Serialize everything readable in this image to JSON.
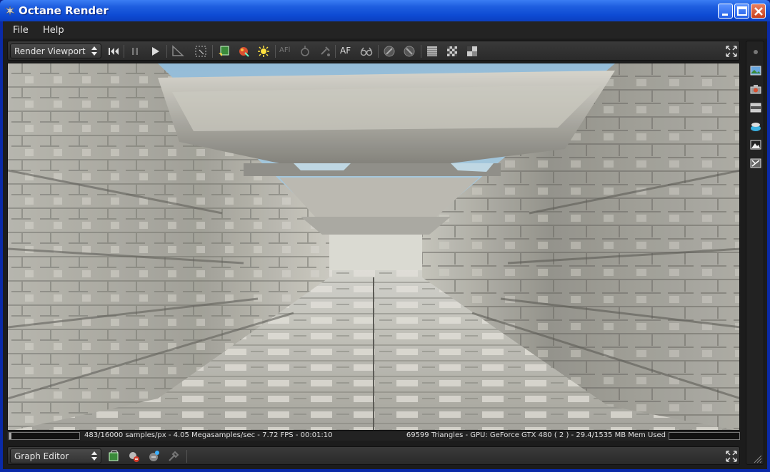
{
  "window": {
    "title": "Octane Render"
  },
  "menu": {
    "items": [
      {
        "label": "File"
      },
      {
        "label": "Help"
      }
    ]
  },
  "toolbar": {
    "view_selector": "Render Viewport",
    "af_label": "AF",
    "afl_label": "AFl"
  },
  "status": {
    "left": "483/16000 samples/px - 4.05 Megasamples/sec - 7.72 FPS - 00:01:10",
    "right": "69599 Triangles - GPU: GeForce GTX 480 ( 2 ) - 29.4/1535 MB Mem Used",
    "progress_fraction": 0.03
  },
  "graph_toolbar": {
    "view_selector": "Graph Editor"
  },
  "colors": {
    "titlebar": "#1f5fe0",
    "panel": "#2b2b2b",
    "sky": "#a9cde0"
  }
}
